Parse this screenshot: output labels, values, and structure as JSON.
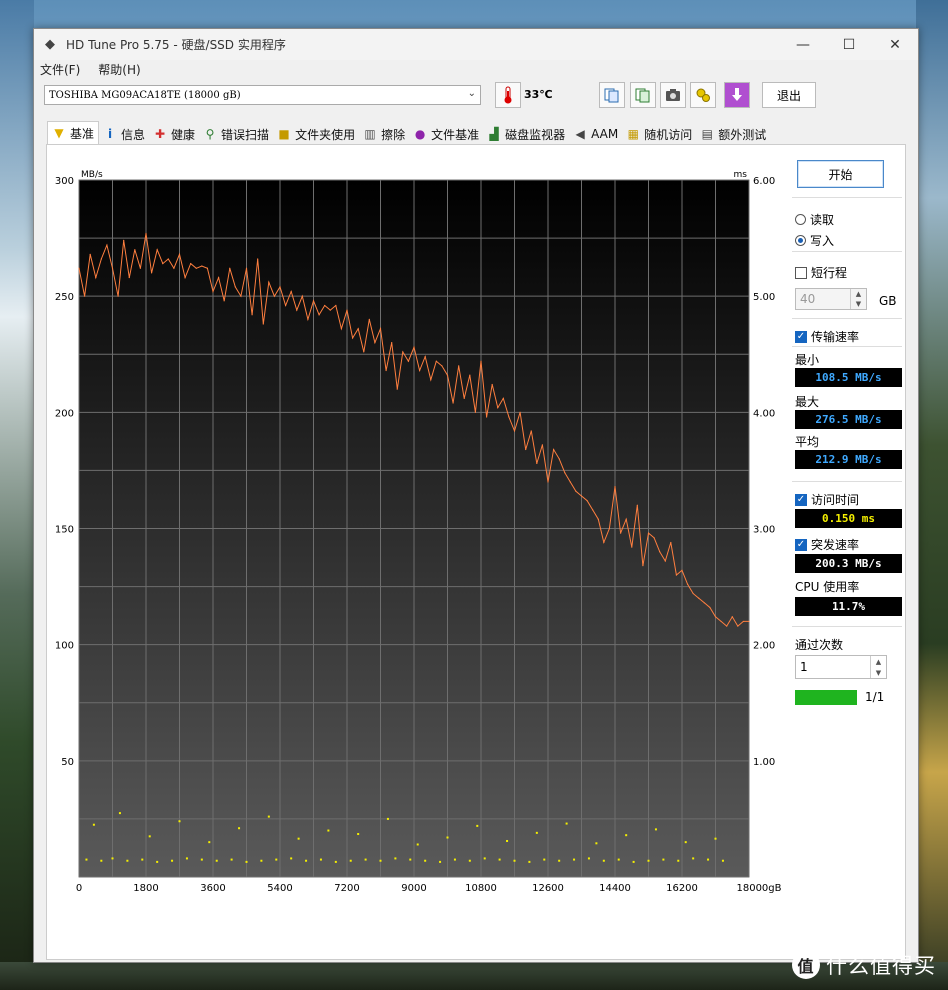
{
  "window": {
    "title": "HD Tune Pro 5.75 - 硬盘/SSD 实用程序",
    "minimize": "—",
    "maximize": "☐",
    "close": "✕"
  },
  "menu": {
    "file": "文件(F)",
    "help": "帮助(H)"
  },
  "toolbar": {
    "drive": "TOSHIBA MG09ACA18TE (18000 gB)",
    "temperature": "33℃",
    "exit_label": "退出"
  },
  "tabs": [
    {
      "label": "基准",
      "icon": "benchmark-icon"
    },
    {
      "label": "信息",
      "icon": "info-icon"
    },
    {
      "label": "健康",
      "icon": "health-icon"
    },
    {
      "label": "错误扫描",
      "icon": "error-scan-icon"
    },
    {
      "label": "文件夹使用",
      "icon": "folder-icon"
    },
    {
      "label": "擦除",
      "icon": "erase-icon"
    },
    {
      "label": "文件基准",
      "icon": "file-benchmark-icon"
    },
    {
      "label": "磁盘监视器",
      "icon": "disk-monitor-icon"
    },
    {
      "label": "AAM",
      "icon": "speaker-icon"
    },
    {
      "label": "随机访问",
      "icon": "random-access-icon"
    },
    {
      "label": "额外测试",
      "icon": "extra-tests-icon"
    }
  ],
  "side": {
    "start_label": "开始",
    "read_label": "读取",
    "write_label": "写入",
    "mode_selected": "write",
    "short_stroke_label": "短行程",
    "short_stroke_checked": false,
    "short_stroke_value": "40",
    "gb_label": "GB",
    "transfer_rate_label": "传输速率",
    "transfer_rate_checked": true,
    "min_label": "最小",
    "min_value": "108.5 MB/s",
    "max_label": "最大",
    "max_value": "276.5 MB/s",
    "avg_label": "平均",
    "avg_value": "212.9 MB/s",
    "access_time_label": "访问时间",
    "access_time_checked": true,
    "access_time_value": "0.150 ms",
    "burst_rate_label": "突发速率",
    "burst_rate_checked": true,
    "burst_rate_value": "200.3 MB/s",
    "cpu_label": "CPU 使用率",
    "cpu_value": "11.7%",
    "passes_label": "通过次数",
    "passes_value": "1",
    "progress_fraction": 1.0,
    "progress_text": "1/1"
  },
  "chart_data": {
    "type": "line",
    "ylabel_left": "MB/s",
    "ylabel_right": "ms",
    "ylim_left": [
      0,
      300
    ],
    "ylim_right": [
      0,
      6
    ],
    "xlim": [
      0,
      18000
    ],
    "x_unit": "gB",
    "left_ticks": [
      "300",
      "250",
      "200",
      "150",
      "100",
      "50"
    ],
    "right_ticks": [
      "6.00",
      "5.00",
      "4.00",
      "3.00",
      "2.00",
      "1.00"
    ],
    "x_ticks": [
      "0",
      "1800",
      "3600",
      "5400",
      "7200",
      "9000",
      "10800",
      "12600",
      "14400",
      "16200",
      "18000gB"
    ],
    "grid": true,
    "series": [
      {
        "color": "#ff7f3f",
        "x": [
          0,
          150,
          300,
          450,
          600,
          750,
          900,
          1050,
          1200,
          1350,
          1500,
          1650,
          1800,
          1950,
          2100,
          2250,
          2400,
          2550,
          2700,
          2850,
          3000,
          3150,
          3300,
          3450,
          3600,
          3750,
          3900,
          4050,
          4200,
          4350,
          4500,
          4650,
          4800,
          4950,
          5100,
          5250,
          5400,
          5550,
          5700,
          5850,
          6000,
          6150,
          6300,
          6450,
          6600,
          6750,
          6900,
          7050,
          7200,
          7350,
          7500,
          7650,
          7800,
          7950,
          8100,
          8250,
          8400,
          8550,
          8700,
          8850,
          9000,
          9150,
          9300,
          9450,
          9600,
          9750,
          9900,
          10050,
          10200,
          10350,
          10500,
          10650,
          10800,
          10950,
          11100,
          11250,
          11400,
          11550,
          11700,
          11850,
          12000,
          12150,
          12300,
          12450,
          12600,
          12750,
          12900,
          13050,
          13200,
          13350,
          13500,
          13650,
          13800,
          13950,
          14100,
          14250,
          14400,
          14550,
          14700,
          14850,
          15000,
          15150,
          15300,
          15450,
          15600,
          15750,
          15900,
          16050,
          16200,
          16350,
          16500,
          16650,
          16800,
          16950,
          17100,
          17250,
          17400,
          17550,
          17700,
          17850,
          18000
        ],
        "values": [
          262,
          250,
          268,
          258,
          266,
          272,
          262,
          250,
          274,
          258,
          270,
          262,
          277,
          260,
          270,
          264,
          266,
          262,
          268,
          258,
          264,
          262,
          263,
          262,
          252,
          258,
          248,
          262,
          254,
          250,
          262,
          242,
          266,
          238,
          256,
          250,
          254,
          246,
          252,
          244,
          250,
          240,
          248,
          242,
          246,
          244,
          246,
          236,
          244,
          232,
          236,
          226,
          240,
          230,
          236,
          218,
          230,
          210,
          226,
          222,
          228,
          218,
          224,
          214,
          222,
          220,
          216,
          204,
          220,
          206,
          216,
          200,
          222,
          198,
          212,
          202,
          206,
          198,
          192,
          200,
          184,
          192,
          178,
          186,
          170,
          184,
          180,
          174,
          170,
          166,
          164,
          162,
          158,
          154,
          144,
          150,
          168,
          148,
          154,
          142,
          160,
          134,
          148,
          146,
          140,
          136,
          144,
          130,
          132,
          126,
          122,
          120,
          118,
          116,
          112,
          110,
          108,
          112,
          108,
          110,
          110
        ]
      },
      {
        "color": "#f5f000",
        "type": "scatter",
        "x": [
          200,
          600,
          900,
          1300,
          1700,
          2100,
          2500,
          2900,
          3300,
          3700,
          4100,
          4500,
          4900,
          5300,
          5700,
          6100,
          6500,
          6900,
          7300,
          7700,
          8100,
          8500,
          8900,
          9300,
          9700,
          10100,
          10500,
          10900,
          11300,
          11700,
          12100,
          12500,
          12900,
          13300,
          13700,
          14100,
          14500,
          14900,
          15300,
          15700,
          16100,
          16500,
          16900,
          17300,
          400,
          1100,
          1900,
          2700,
          3500,
          4300,
          5100,
          5900,
          6700,
          7500,
          8300,
          9100,
          9900,
          10700,
          11500,
          12300,
          13100,
          13900,
          14700,
          15500,
          16300,
          17100
        ],
        "values": [
          0.15,
          0.14,
          0.16,
          0.14,
          0.15,
          0.13,
          0.14,
          0.16,
          0.15,
          0.14,
          0.15,
          0.13,
          0.14,
          0.15,
          0.16,
          0.14,
          0.15,
          0.13,
          0.14,
          0.15,
          0.14,
          0.16,
          0.15,
          0.14,
          0.13,
          0.15,
          0.14,
          0.16,
          0.15,
          0.14,
          0.13,
          0.15,
          0.14,
          0.15,
          0.16,
          0.14,
          0.15,
          0.13,
          0.14,
          0.15,
          0.14,
          0.16,
          0.15,
          0.14,
          0.45,
          0.55,
          0.35,
          0.48,
          0.3,
          0.42,
          0.52,
          0.33,
          0.4,
          0.37,
          0.5,
          0.28,
          0.34,
          0.44,
          0.31,
          0.38,
          0.46,
          0.29,
          0.36,
          0.41,
          0.3,
          0.33
        ]
      }
    ]
  }
}
